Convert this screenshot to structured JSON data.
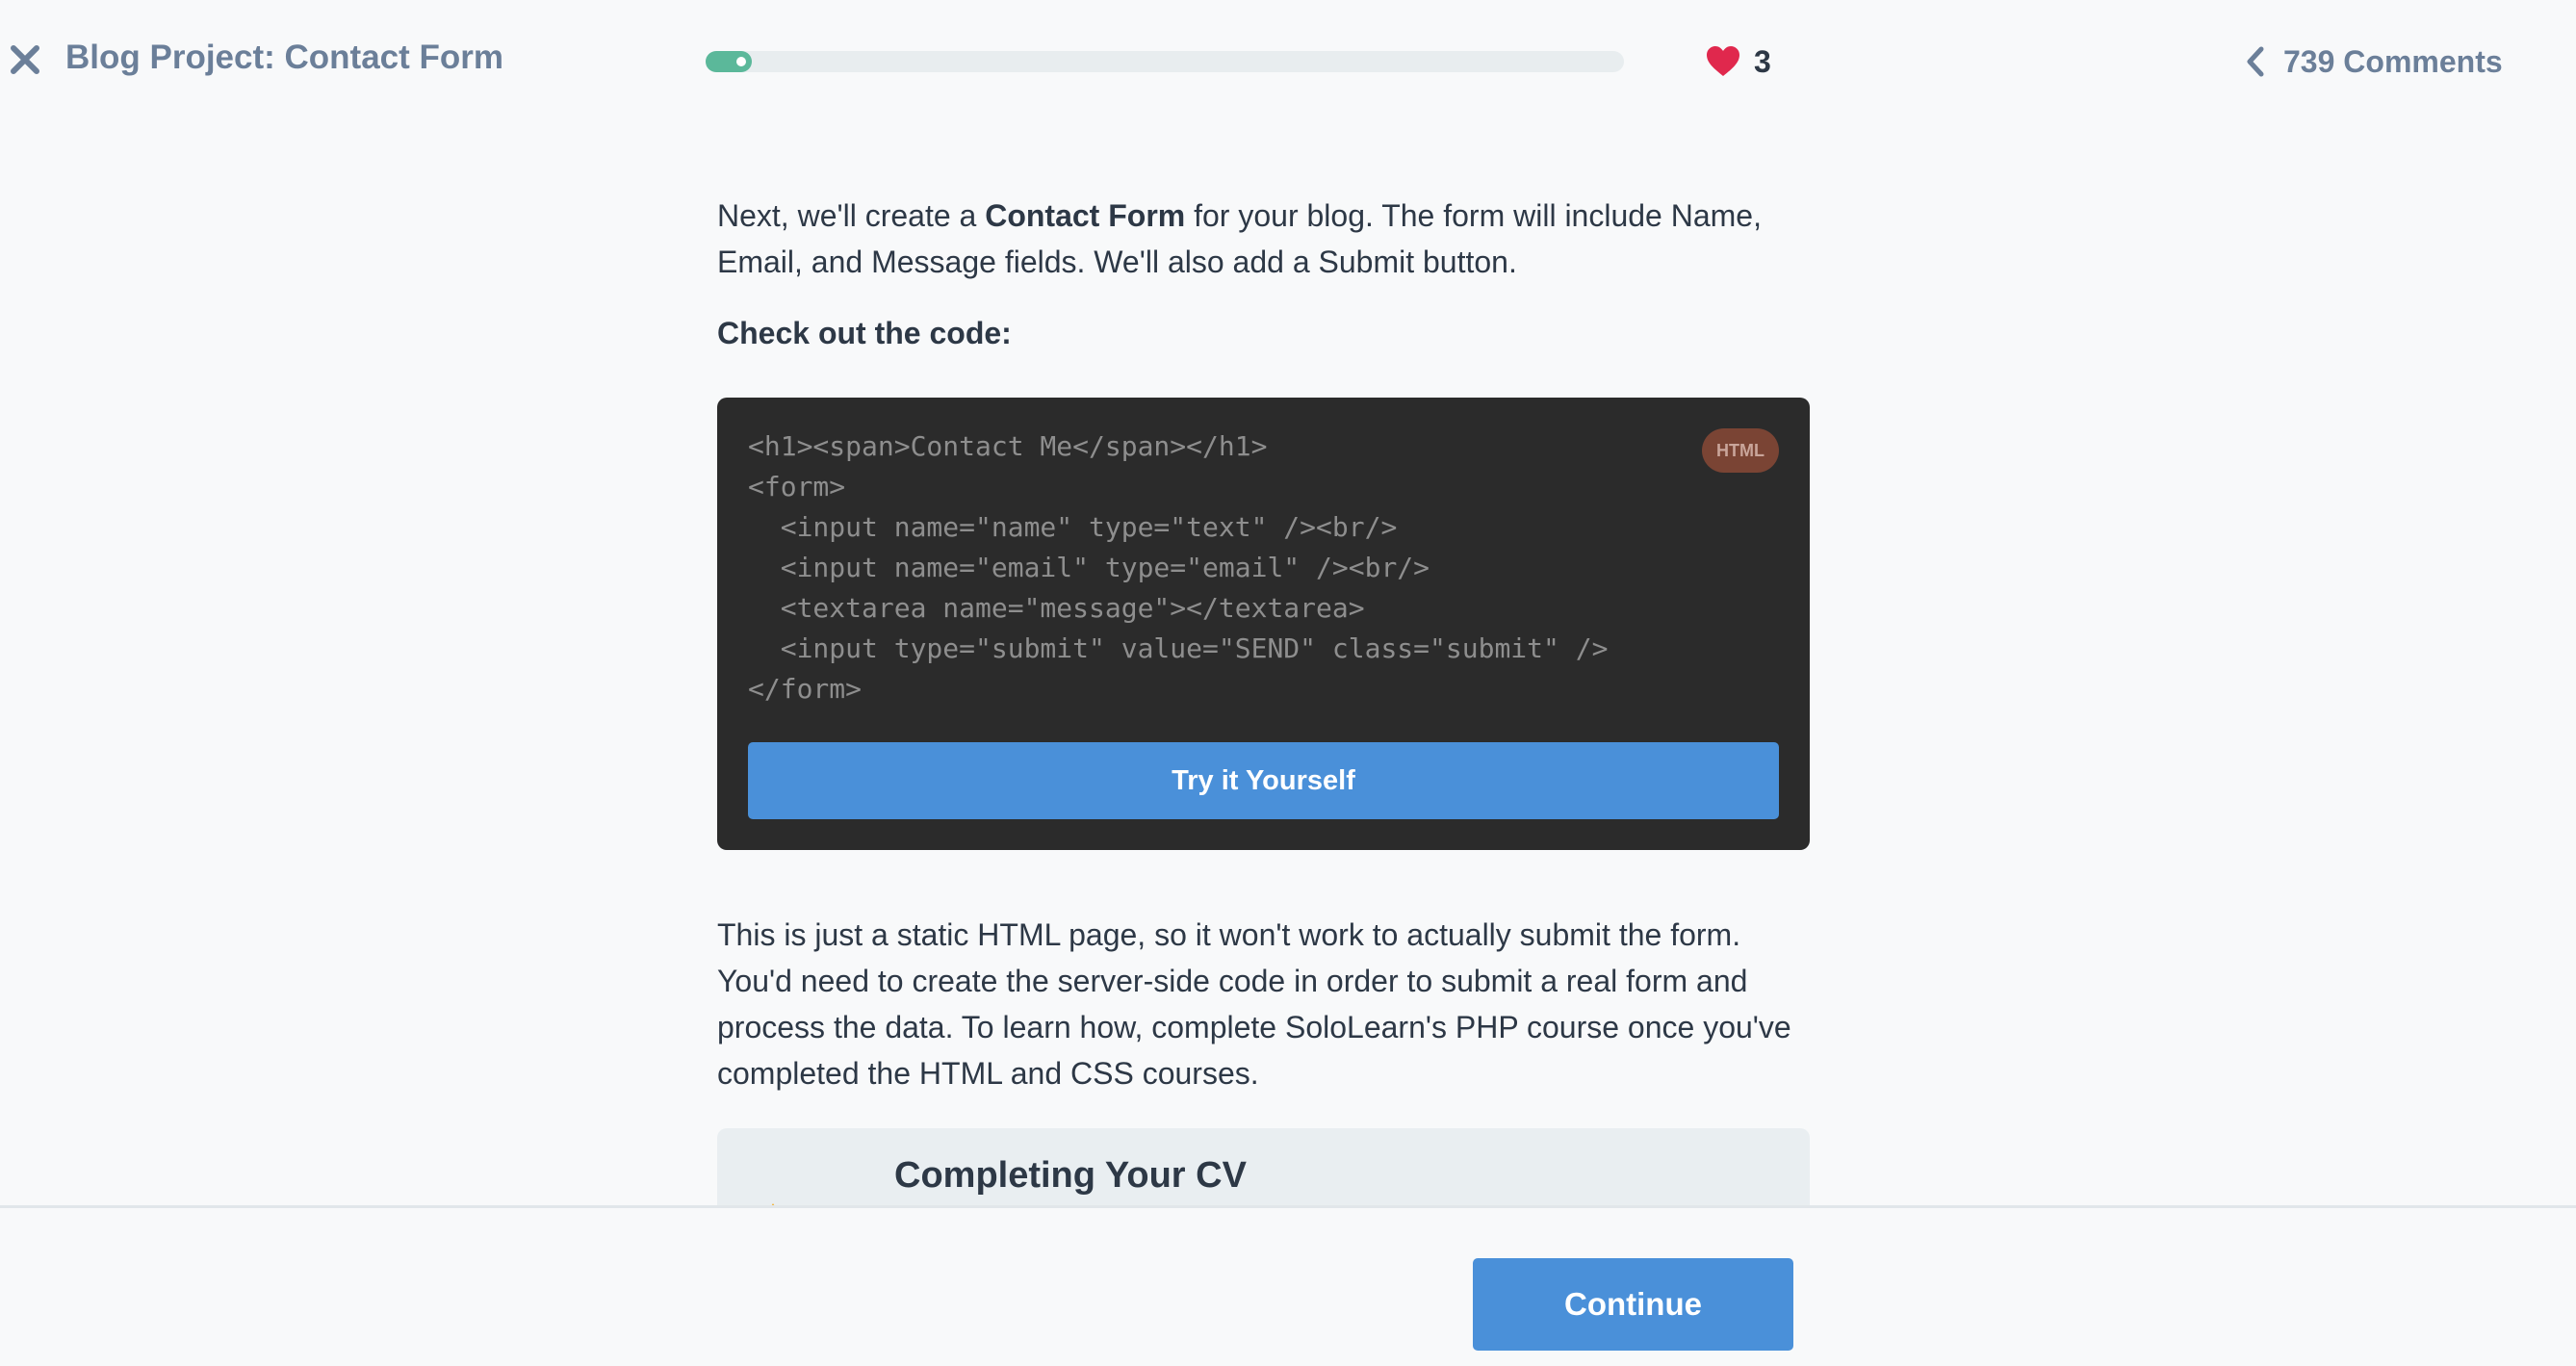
{
  "header": {
    "title": "Blog Project: Contact Form",
    "progress": 0.05,
    "likes_count": "3",
    "comments_label": "739 Comments"
  },
  "lesson": {
    "intro_before": "Next, we'll create a ",
    "intro_bold": "Contact Form",
    "intro_after": " for your blog. The form will include Name, Email, and Message fields. We'll also add a Submit button.",
    "subheading": "Check out the code:",
    "code": "<h1><span>Contact Me</span></h1>\n<form>\n  <input name=\"name\" type=\"text\" /><br/>\n  <input name=\"email\" type=\"email\" /><br/>\n  <textarea name=\"message\"></textarea>\n  <input type=\"submit\" value=\"SEND\" class=\"submit\" />\n</form>",
    "code_language": "HTML",
    "try_button": "Try it Yourself",
    "note": "This is just a static HTML page, so it won't work to actually submit the form. You'd need to create the server-side code in order to submit a real form and process the data. To learn how, complete SoloLearn's PHP course once you've completed the HTML and CSS courses."
  },
  "next_card": {
    "title": "Completing Your CV"
  },
  "footer": {
    "continue_label": "Continue"
  },
  "colors": {
    "accent": "#4a90d9",
    "progress": "#5bb89a",
    "heart": "#e0284d",
    "code_bg": "#2b2b2b"
  },
  "icons": {
    "close": "close-icon",
    "heart": "heart-icon",
    "back": "chevron-left-icon",
    "next_card": "rocket-icon"
  }
}
